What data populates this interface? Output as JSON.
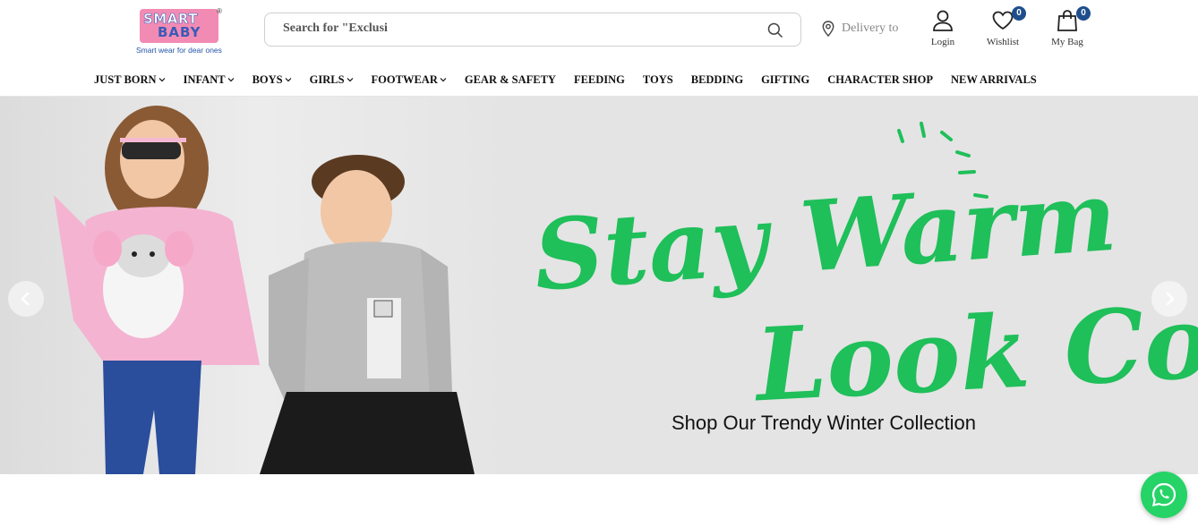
{
  "logo": {
    "line1": "SMART",
    "line2": "BABY",
    "registered": "®",
    "tagline": "Smart wear for dear ones"
  },
  "search": {
    "placeholder": "Search for \"Exclusi"
  },
  "delivery": {
    "label": "Delivery to"
  },
  "actions": {
    "login": {
      "label": "Login"
    },
    "wishlist": {
      "label": "Wishlist",
      "count": "0"
    },
    "bag": {
      "label": "My Bag",
      "count": "0"
    }
  },
  "nav": {
    "items": [
      {
        "label": "JUST BORN",
        "dropdown": true
      },
      {
        "label": "INFANT",
        "dropdown": true
      },
      {
        "label": "BOYS",
        "dropdown": true
      },
      {
        "label": "GIRLS",
        "dropdown": true
      },
      {
        "label": "FOOTWEAR",
        "dropdown": true
      },
      {
        "label": "GEAR & SAFETY",
        "dropdown": false
      },
      {
        "label": "FEEDING",
        "dropdown": false
      },
      {
        "label": "TOYS",
        "dropdown": false
      },
      {
        "label": "BEDDING",
        "dropdown": false
      },
      {
        "label": "GIFTING",
        "dropdown": false
      },
      {
        "label": "CHARACTER SHOP",
        "dropdown": false
      },
      {
        "label": "NEW ARRIVALS",
        "dropdown": false
      }
    ]
  },
  "banner": {
    "headline_line1": "Stay Warm",
    "headline_line2": "Look Cool",
    "subtitle": "Shop Our Trendy Winter Collection",
    "headline_color": "#1fbf5a"
  },
  "colors": {
    "brand_pink": "#f28bb3",
    "brand_blue": "#3a5bb8",
    "badge": "#1f4e8c",
    "whatsapp": "#25d366"
  }
}
